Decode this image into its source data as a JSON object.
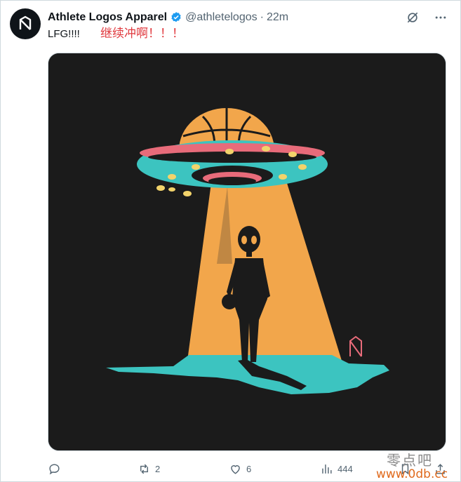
{
  "post": {
    "display_name": "Athlete Logos Apparel",
    "handle": "@athletelogos",
    "separator": "·",
    "time": "22m",
    "text": "LFG!!!!",
    "annotation": "继续冲啊！！！"
  },
  "media": {
    "description_icon": "ufo-alien-basketball-illustration"
  },
  "actions": {
    "reply_count": "",
    "retweet_count": "2",
    "like_count": "6",
    "views_count": "444"
  },
  "watermark": {
    "cn_text": "零点吧",
    "url_text": "www.0db.cc"
  },
  "colors": {
    "verified": "#1d9bf0",
    "text_secondary": "#536471",
    "ufo_teal": "#3cc4c0",
    "ufo_pink": "#e86b7a",
    "beam_orange": "#f2a64b",
    "background_dark": "#1b1b1b"
  }
}
